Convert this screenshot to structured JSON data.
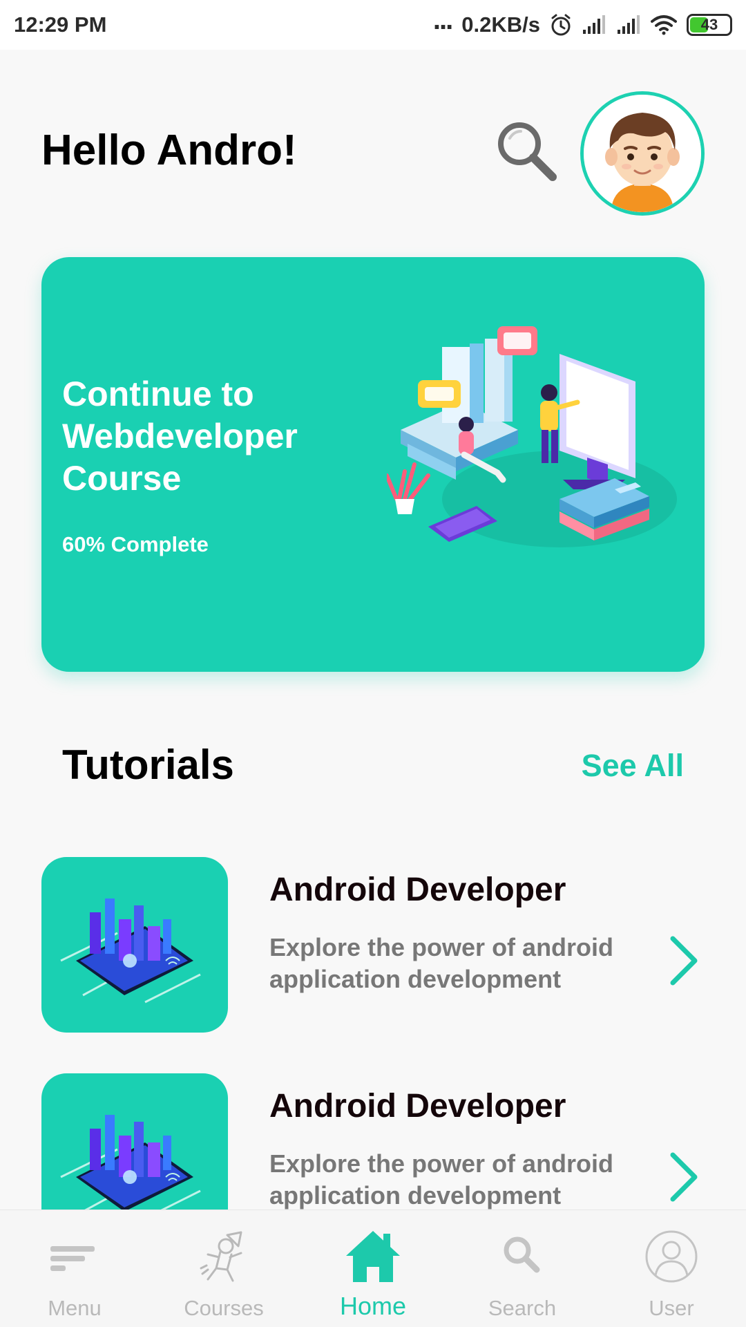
{
  "status_bar": {
    "time": "12:29 PM",
    "dots": "...",
    "net_speed": "0.2KB/s",
    "battery": "43",
    "battery_level": 0.43,
    "icons": [
      "alarm-icon",
      "signal-icon",
      "signal-icon",
      "wifi-icon",
      "battery-icon"
    ]
  },
  "header": {
    "greeting": "Hello Andro!",
    "search_icon": "search-icon",
    "avatar_icon": "avatar"
  },
  "hero": {
    "title": "Continue to Webdeveloper Course",
    "progress_text": "60% Complete",
    "progress": 0.6,
    "color": "#1ad0b2"
  },
  "tutorials": {
    "title": "Tutorials",
    "see_all": "See All",
    "items": [
      {
        "title": "Android Developer",
        "description": "Explore the power of android application development"
      },
      {
        "title": "Android Developer",
        "description": "Explore the power of android application development"
      }
    ]
  },
  "bottom_nav": {
    "items": [
      {
        "label": "Menu",
        "icon": "menu-icon"
      },
      {
        "label": "Courses",
        "icon": "courses-icon"
      },
      {
        "label": "Home",
        "icon": "home-icon",
        "active": true
      },
      {
        "label": "Search",
        "icon": "search-icon"
      },
      {
        "label": "User",
        "icon": "user-icon"
      }
    ]
  },
  "colors": {
    "accent": "#1dc9ab",
    "card": "#1ad0b2",
    "muted": "#b9b9b9"
  }
}
